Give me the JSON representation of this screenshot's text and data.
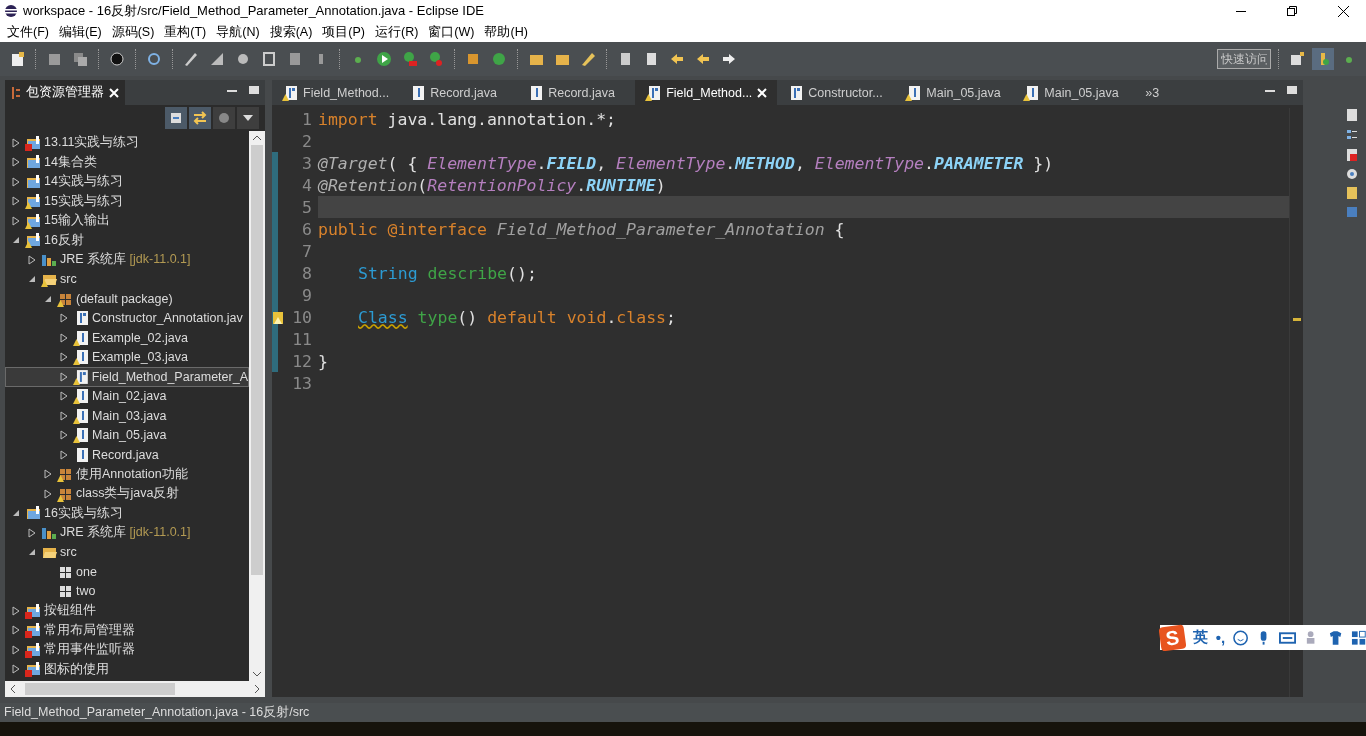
{
  "window": {
    "title": "workspace - 16反射/src/Field_Method_Parameter_Annotation.java - Eclipse IDE"
  },
  "menu": [
    "文件(F)",
    "编辑(E)",
    "源码(S)",
    "重构(T)",
    "导航(N)",
    "搜索(A)",
    "项目(P)",
    "运行(R)",
    "窗口(W)",
    "帮助(H)"
  ],
  "quick_access": {
    "placeholder": "快速访问"
  },
  "explorer": {
    "title": "包资源管理器",
    "selected": true,
    "tree": [
      {
        "label": "13.11实践与练习",
        "kind": "project",
        "error": true,
        "warning": false,
        "expanded": false,
        "selected": false
      },
      {
        "label": "14集合类",
        "kind": "project",
        "error": false,
        "warning": false,
        "expanded": false,
        "selected": false
      },
      {
        "label": "14实践与练习",
        "kind": "project",
        "error": false,
        "warning": false,
        "expanded": false,
        "selected": false
      },
      {
        "label": "15实践与练习",
        "kind": "project",
        "error": false,
        "warning": true,
        "expanded": false,
        "selected": false
      },
      {
        "label": "15输入输出",
        "kind": "project",
        "error": false,
        "warning": true,
        "expanded": false,
        "selected": false
      },
      {
        "label": "16反射",
        "kind": "project",
        "error": false,
        "warning": true,
        "expanded": true,
        "selected": false,
        "children": [
          {
            "label": "JRE 系统库",
            "decoration": "[jdk-11.0.1]",
            "kind": "library",
            "error": false,
            "warning": false,
            "expanded": false,
            "selected": false
          },
          {
            "label": "src",
            "kind": "folder",
            "error": false,
            "warning": true,
            "expanded": true,
            "selected": false,
            "children": [
              {
                "label": "(default package)",
                "kind": "package",
                "error": false,
                "warning": true,
                "expanded": true,
                "selected": false,
                "children": [
                  {
                    "label": "Constructor_Annotation.jav",
                    "kind": "annotation",
                    "error": false,
                    "warning": false,
                    "expanded": false,
                    "selected": false
                  },
                  {
                    "label": "Example_02.java",
                    "kind": "java",
                    "error": false,
                    "warning": true,
                    "expanded": false,
                    "selected": false
                  },
                  {
                    "label": "Example_03.java",
                    "kind": "java",
                    "error": false,
                    "warning": true,
                    "expanded": false,
                    "selected": false
                  },
                  {
                    "label": "Field_Method_Parameter_A",
                    "kind": "annotation",
                    "error": false,
                    "warning": true,
                    "expanded": false,
                    "selected": true
                  },
                  {
                    "label": "Main_02.java",
                    "kind": "java",
                    "error": false,
                    "warning": true,
                    "expanded": false,
                    "selected": false
                  },
                  {
                    "label": "Main_03.java",
                    "kind": "java",
                    "error": false,
                    "warning": true,
                    "expanded": false,
                    "selected": false
                  },
                  {
                    "label": "Main_05.java",
                    "kind": "java",
                    "error": false,
                    "warning": true,
                    "expanded": false,
                    "selected": false
                  },
                  {
                    "label": "Record.java",
                    "kind": "java",
                    "error": false,
                    "warning": false,
                    "expanded": false,
                    "selected": false
                  }
                ]
              },
              {
                "label": "使用Annotation功能",
                "kind": "package",
                "error": false,
                "warning": true,
                "expanded": false,
                "selected": false
              },
              {
                "label": "class类与java反射",
                "kind": "package",
                "error": false,
                "warning": true,
                "expanded": false,
                "selected": false
              }
            ]
          }
        ]
      },
      {
        "label": "16实践与练习",
        "kind": "project",
        "error": false,
        "warning": false,
        "expanded": true,
        "selected": false,
        "children": [
          {
            "label": "JRE 系统库",
            "decoration": "[jdk-11.0.1]",
            "kind": "library",
            "error": false,
            "warning": false,
            "expanded": false,
            "selected": false
          },
          {
            "label": "src",
            "kind": "folder",
            "error": false,
            "warning": false,
            "expanded": true,
            "selected": false,
            "children": [
              {
                "label": "one",
                "kind": "empty-package",
                "error": false,
                "warning": false,
                "selected": false
              },
              {
                "label": "two",
                "kind": "empty-package",
                "error": false,
                "warning": false,
                "selected": false
              }
            ]
          }
        ]
      },
      {
        "label": "按钮组件",
        "kind": "project",
        "error": true,
        "warning": false,
        "expanded": false,
        "selected": false
      },
      {
        "label": "常用布局管理器",
        "kind": "project",
        "error": true,
        "warning": false,
        "expanded": false,
        "selected": false
      },
      {
        "label": "常用事件监听器",
        "kind": "project",
        "error": true,
        "warning": false,
        "expanded": false,
        "selected": false
      },
      {
        "label": "图标的使用",
        "kind": "project",
        "error": true,
        "warning": false,
        "expanded": false,
        "selected": false
      }
    ]
  },
  "editor_tabs": [
    {
      "label": "Field_Method...",
      "kind": "annotation",
      "warning": true,
      "selected": false
    },
    {
      "label": "Record.java",
      "kind": "java",
      "warning": false,
      "selected": false
    },
    {
      "label": "Record.java",
      "kind": "java",
      "warning": false,
      "selected": false
    },
    {
      "label": "Field_Method...",
      "kind": "annotation",
      "warning": true,
      "selected": true
    },
    {
      "label": "Constructor...",
      "kind": "annotation",
      "warning": false,
      "selected": false
    },
    {
      "label": "Main_05.java",
      "kind": "java",
      "warning": true,
      "selected": false
    },
    {
      "label": "Main_05.java",
      "kind": "java",
      "warning": true,
      "selected": false
    }
  ],
  "tab_overflow": "»3",
  "code": [
    {
      "number": "1",
      "changed": false,
      "warning": false,
      "tokens": [
        {
          "kind": "keyword",
          "text": "import"
        },
        {
          "kind": "plain",
          "text": " java.lang.annotation.*;"
        }
      ]
    },
    {
      "number": "2",
      "changed": false,
      "warning": false
    },
    {
      "number": "3",
      "changed": true,
      "warning": false,
      "tokens": [
        {
          "kind": "annotation",
          "text": "@Target"
        },
        {
          "kind": "plain",
          "text": "( { "
        },
        {
          "kind": "enum",
          "text": "ElementType"
        },
        {
          "kind": "plain",
          "text": "."
        },
        {
          "kind": "constant",
          "text": "FIELD"
        },
        {
          "kind": "plain",
          "text": ", "
        },
        {
          "kind": "enum",
          "text": "ElementType"
        },
        {
          "kind": "plain",
          "text": "."
        },
        {
          "kind": "constant",
          "text": "METHOD"
        },
        {
          "kind": "plain",
          "text": ", "
        },
        {
          "kind": "enum",
          "text": "ElementType"
        },
        {
          "kind": "plain",
          "text": "."
        },
        {
          "kind": "constant",
          "text": "PARAMETER"
        },
        {
          "kind": "plain",
          "text": " })"
        }
      ]
    },
    {
      "number": "4",
      "changed": true,
      "warning": false,
      "tokens": [
        {
          "kind": "annotation",
          "text": "@Retention"
        },
        {
          "kind": "plain",
          "text": "("
        },
        {
          "kind": "enum",
          "text": "RetentionPolicy"
        },
        {
          "kind": "plain",
          "text": "."
        },
        {
          "kind": "constant",
          "text": "RUNTIME"
        },
        {
          "kind": "plain",
          "text": ")"
        }
      ]
    },
    {
      "number": "5",
      "changed": true,
      "current": true,
      "warning": false
    },
    {
      "number": "6",
      "changed": true,
      "warning": false,
      "tokens": [
        {
          "kind": "keyword",
          "text": "public "
        },
        {
          "kind": "keyword",
          "text": "@interface "
        },
        {
          "kind": "declaration",
          "text": "Field_Method_Parameter_Annotation"
        },
        {
          "kind": "plain",
          "text": " {"
        }
      ]
    },
    {
      "number": "7",
      "changed": true,
      "warning": false
    },
    {
      "number": "8",
      "changed": true,
      "warning": false,
      "indented": true,
      "tokens": [
        {
          "kind": "type",
          "text": "String"
        },
        {
          "kind": "method",
          "text": " describe"
        },
        {
          "kind": "plain",
          "text": "();"
        }
      ]
    },
    {
      "number": "9",
      "changed": true,
      "warning": false
    },
    {
      "number": "10",
      "changed": true,
      "warning": true,
      "indented": true,
      "tokens": [
        {
          "kind": "type-warning",
          "text": "Class"
        },
        {
          "kind": "method",
          "text": " type"
        },
        {
          "kind": "plain",
          "text": "() "
        },
        {
          "kind": "keyword",
          "text": "default void"
        },
        {
          "kind": "plain",
          "text": "."
        },
        {
          "kind": "keyword",
          "text": "class"
        },
        {
          "kind": "plain",
          "text": ";"
        }
      ]
    },
    {
      "number": "11",
      "changed": true,
      "warning": false
    },
    {
      "number": "12",
      "changed": true,
      "warning": false,
      "tokens": [
        {
          "kind": "plain",
          "text": "}"
        }
      ]
    },
    {
      "number": "13",
      "changed": false,
      "warning": false
    }
  ],
  "status_bar": "Field_Method_Parameter_Annotation.java - 16反射/src",
  "ime": {
    "logo": "S",
    "mode": "英",
    "punctuation": "•,"
  }
}
